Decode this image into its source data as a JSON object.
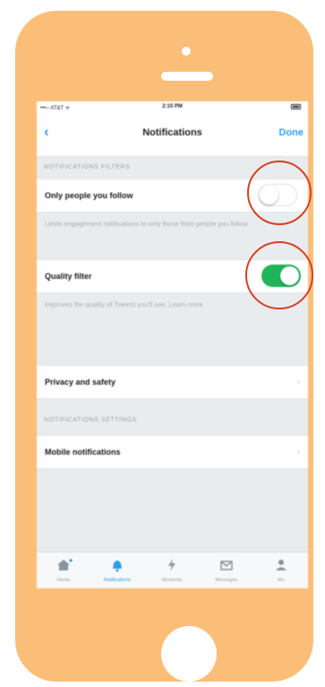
{
  "status_bar": {
    "carrier": "•••○ AT&T ᯤ",
    "time": "2:10 PM"
  },
  "nav": {
    "back_icon": "chevron-left-icon",
    "title": "Notifications",
    "done_label": "Done"
  },
  "filters": {
    "header": "NOTIFICATIONS FILTERS",
    "only_people_label": "Only people you follow",
    "only_people_on": false,
    "only_people_desc": "Limits engagement notifications to only those from people you follow",
    "quality_label": "Quality filter",
    "quality_on": true,
    "quality_desc": "Improves the quality of Tweets you'll see. Learn more"
  },
  "privacy_label": "Privacy and safety",
  "settings": {
    "header": "NOTIFICATIONS SETTINGS",
    "mobile_label": "Mobile notifications"
  },
  "tabs": [
    {
      "label": "Home",
      "icon": "home-icon"
    },
    {
      "label": "Notifications",
      "icon": "bell-icon"
    },
    {
      "label": "Moments",
      "icon": "lightning-icon"
    },
    {
      "label": "Messages",
      "icon": "envelope-icon"
    },
    {
      "label": "Me",
      "icon": "person-icon"
    }
  ],
  "colors": {
    "phone_body": "#fbbe78",
    "accent_blue": "#2d9ee8",
    "toggle_on": "#1fb35a",
    "annotation_circle": "#d93f23"
  }
}
